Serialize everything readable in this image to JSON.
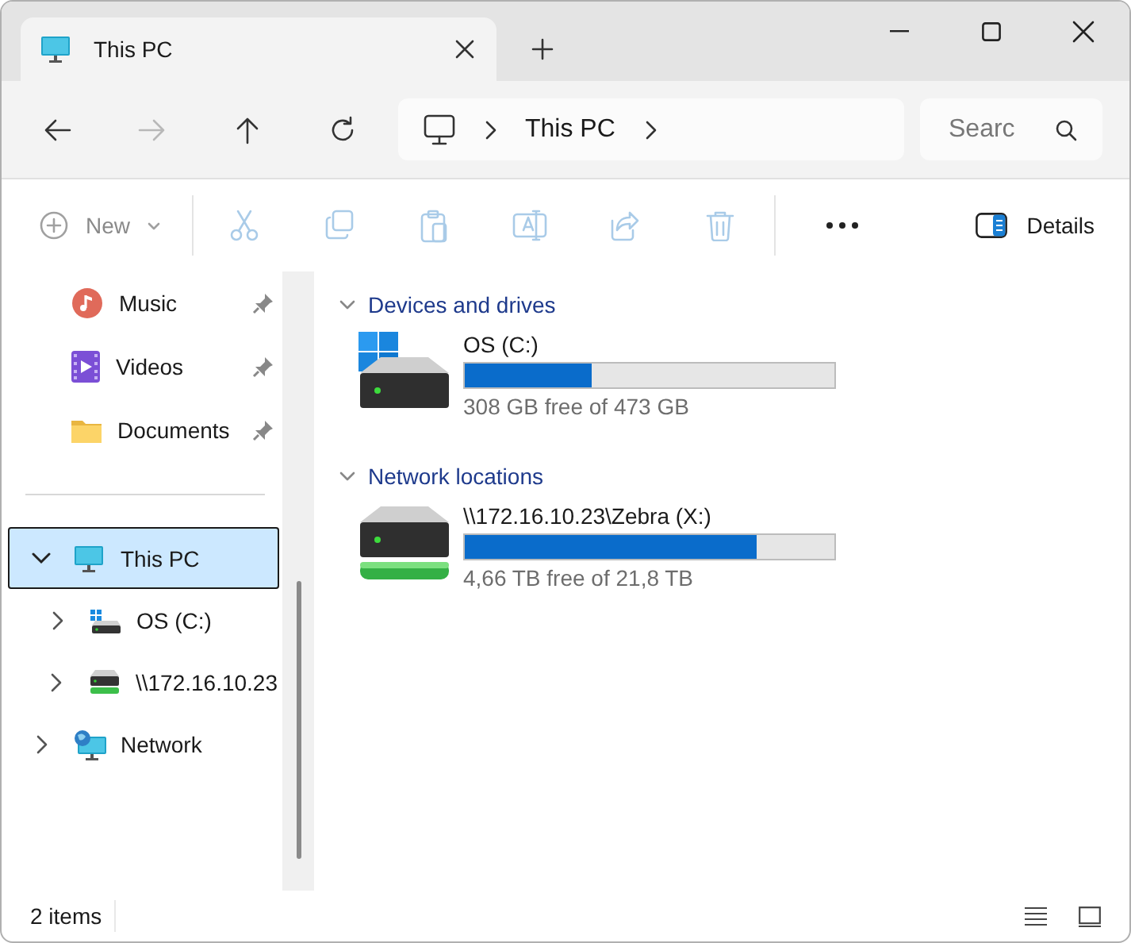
{
  "tabs": [
    {
      "label": "This PC",
      "selected": true
    }
  ],
  "navigation": [
    {
      "kind": "back",
      "disabled": false
    },
    {
      "kind": "forward",
      "disabled": true
    },
    {
      "kind": "up",
      "disabled": false
    },
    {
      "kind": "refresh",
      "disabled": false
    }
  ],
  "address": {
    "segments": [
      "This PC"
    ]
  },
  "search": {
    "placeholder": "Searc"
  },
  "toolbar": {
    "new": {
      "label": "New",
      "disabled": true
    },
    "actions": [
      {
        "kind": "cut",
        "disabled": true
      },
      {
        "kind": "copy",
        "disabled": true
      },
      {
        "kind": "paste",
        "disabled": true
      },
      {
        "kind": "rename",
        "disabled": true
      },
      {
        "kind": "share",
        "disabled": true
      },
      {
        "kind": "delete",
        "disabled": true
      }
    ],
    "details": {
      "label": "Details"
    }
  },
  "sidebar": {
    "pinned": [
      {
        "label": "Music",
        "kind": "music",
        "pinned": true
      },
      {
        "label": "Videos",
        "kind": "videos",
        "pinned": true
      },
      {
        "label": "Documents",
        "kind": "folder",
        "pinned": true
      }
    ],
    "tree": [
      {
        "label": "This PC",
        "kind": "pc",
        "expanded": true,
        "selected": true,
        "children": [
          {
            "label": "OS (C:)",
            "kind": "system",
            "expanded": false,
            "selected": false
          },
          {
            "label": "\\\\172.16.10.23",
            "kind": "network-drive",
            "expanded": false,
            "selected": false
          }
        ]
      },
      {
        "label": "Network",
        "kind": "network",
        "expanded": false,
        "selected": false
      }
    ]
  },
  "sections": [
    {
      "title": "Devices and drives",
      "expanded": true,
      "items": [
        {
          "name": "OS (C:)",
          "kind": "system",
          "level": 0.345,
          "reading": "308 GB free of 473 GB"
        }
      ]
    },
    {
      "title": "Network locations",
      "expanded": true,
      "items": [
        {
          "name": "\\\\172.16.10.23\\Zebra (X:)",
          "kind": "network-drive",
          "level": 0.79,
          "reading": "4,66 TB free of 21,8 TB"
        }
      ]
    }
  ],
  "status_bar": {
    "count": "2 items"
  }
}
